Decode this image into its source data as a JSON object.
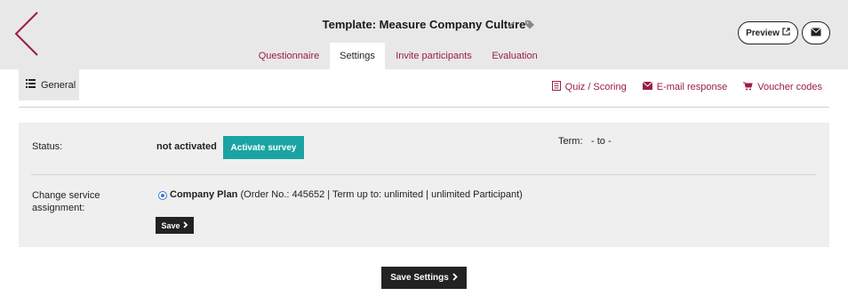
{
  "header": {
    "title": "Template: Measure Company Culture",
    "preview_label": "Preview"
  },
  "tabs": [
    {
      "label": "Questionnaire",
      "active": false
    },
    {
      "label": "Settings",
      "active": true
    },
    {
      "label": "Invite participants",
      "active": false
    },
    {
      "label": "Evaluation",
      "active": false
    }
  ],
  "subnav": {
    "general_label": "General",
    "links": [
      {
        "label": "Quiz / Scoring",
        "icon": "list-icon"
      },
      {
        "label": "E-mail response",
        "icon": "envelope-icon"
      },
      {
        "label": "Voucher codes",
        "icon": "cart-icon"
      }
    ]
  },
  "settings": {
    "status_label": "Status:",
    "status_value": "not activated",
    "activate_label": "Activate survey",
    "term_label": "Term:",
    "term_value": "- to -",
    "service_label": "Change service assignment:",
    "plan_name": "Company Plan",
    "plan_details": "(Order No.: 445652 | Term up to: unlimited | unlimited Participant)",
    "plan_selected": true,
    "save_label": "Save"
  },
  "footer": {
    "save_settings_label": "Save Settings"
  },
  "colors": {
    "accent": "#9b1c4b",
    "teal": "#1aa3a3",
    "dark": "#222222",
    "header_bg": "#e8e8e8",
    "panel_bg": "#efefef"
  }
}
